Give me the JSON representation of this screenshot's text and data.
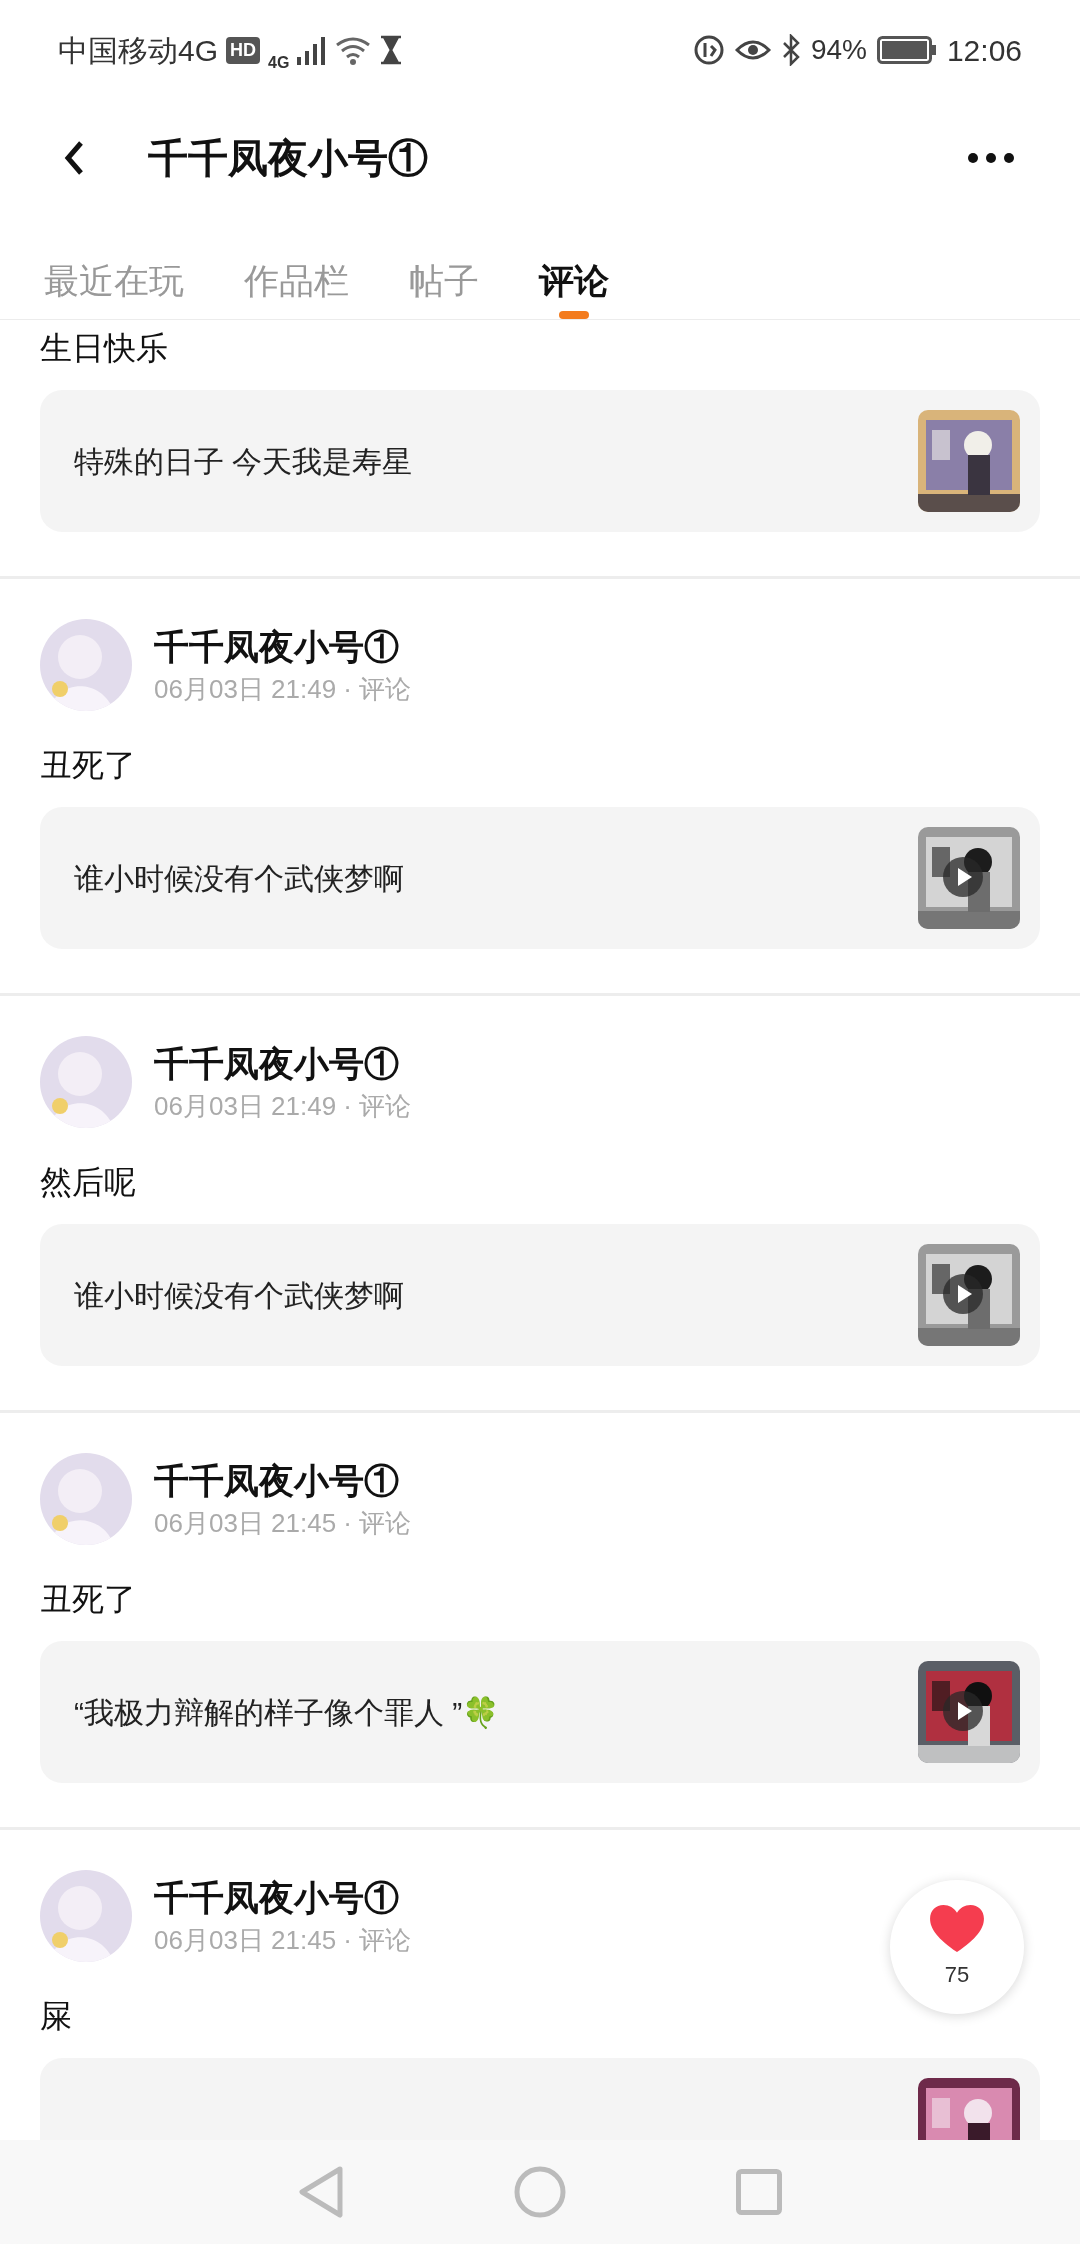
{
  "status_bar": {
    "carrier": "中国移动4G",
    "hd": "HD",
    "network": "4G",
    "battery": "94%",
    "time": "12:06"
  },
  "header": {
    "title": "千千凤夜小号①"
  },
  "tabs": [
    {
      "label": "最近在玩",
      "selected": false
    },
    {
      "label": "作品栏",
      "selected": false
    },
    {
      "label": "帖子",
      "selected": false
    },
    {
      "label": "评论",
      "selected": true
    }
  ],
  "comments": [
    {
      "comment": "生日快乐",
      "card_text": "特殊的日子 今天我是寿星"
    },
    {
      "author": "千千凤夜小号①",
      "meta": "06月03日 21:49 · 评论",
      "comment": "丑死了",
      "card_text": "谁小时候没有个武侠梦啊",
      "thumbnail": {
        "kind": "video"
      }
    },
    {
      "author": "千千凤夜小号①",
      "meta": "06月03日 21:49 · 评论",
      "comment": "然后呢",
      "card_text": "谁小时候没有个武侠梦啊",
      "thumbnail": {
        "kind": "video"
      }
    },
    {
      "author": "千千凤夜小号①",
      "meta": "06月03日 21:45 · 评论",
      "comment": "丑死了",
      "card_text": "“我极力辩解的样子像个罪人 ”🍀",
      "thumbnail": {
        "kind": "video"
      }
    },
    {
      "author": "千千凤夜小号①",
      "meta": "06月03日 21:45 · 评论",
      "comment": "屎"
    }
  ],
  "like_button": {
    "count": "75"
  }
}
